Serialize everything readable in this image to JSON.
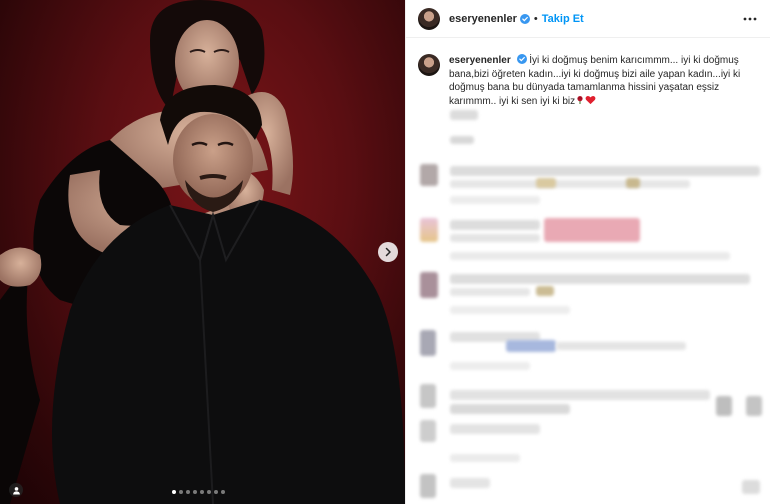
{
  "post": {
    "username": "eseryenenler",
    "separator": "•",
    "follow_label": "Takip Et",
    "caption": "İyi ki doğmuş benim karıcımmm... iyi ki doğmuş bana,bizi öğreten kadın...iyi ki doğmuş bizi aile yapan kadın...iyi ki doğmuş bana bu dünyada tamamlanma hissini yaşatan eşsiz karımmm.. iyi ki sen iyi ki biz",
    "caption_emojis": [
      "rose",
      "red-heart"
    ]
  },
  "carousel": {
    "total": 8,
    "active_index": 0
  },
  "colors": {
    "accent": "#0095f6",
    "verified": "#3897f0",
    "text": "#262626"
  }
}
